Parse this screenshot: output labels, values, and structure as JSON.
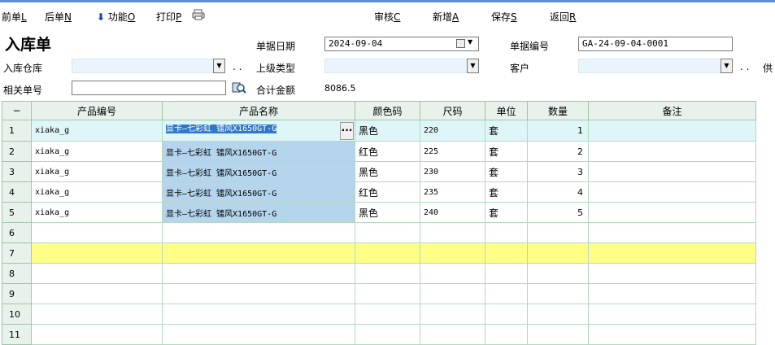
{
  "toolbar": {
    "prev": {
      "label": "前单",
      "key": "L"
    },
    "next": {
      "label": "后单",
      "key": "N"
    },
    "function": {
      "label": "功能",
      "key": "O"
    },
    "print": {
      "label": "打印",
      "key": "P"
    },
    "review": {
      "label": "审核",
      "key": "C"
    },
    "new": {
      "label": "新增",
      "key": "A"
    },
    "save": {
      "label": "保存",
      "key": "S"
    },
    "back": {
      "label": "返回",
      "key": "R"
    }
  },
  "form": {
    "title": "入库单",
    "date_label": "单据日期",
    "date_value": "2024-09-04",
    "docno_label": "单据编号",
    "docno_value": "GA-24-09-04-0001",
    "warehouse_label": "入库仓库",
    "warehouse_value": "",
    "parent_type_label": "上级类型",
    "parent_type_value": "",
    "customer_label": "客户",
    "customer_value": "",
    "supplier_label_partial": "供",
    "related_label": "相关单号",
    "related_value": "",
    "total_label": "合计金额",
    "total_value": "8086.5",
    "ellipsis": ". ."
  },
  "grid": {
    "corner": "−",
    "headers": [
      "产品编号",
      "产品名称",
      "颜色码",
      "尺码",
      "单位",
      "数量",
      "备注"
    ],
    "rows": [
      {
        "n": "1",
        "code": "xiaka_g",
        "name": "显卡—七彩虹 镭风X1650GT-G",
        "color": "黑色",
        "size": "220",
        "unit": "套",
        "qty": "1",
        "note": ""
      },
      {
        "n": "2",
        "code": "xiaka_g",
        "name": "显卡—七彩虹 镭风X1650GT-G",
        "color": "红色",
        "size": "225",
        "unit": "套",
        "qty": "2",
        "note": ""
      },
      {
        "n": "3",
        "code": "xiaka_g",
        "name": "显卡—七彩虹 镭风X1650GT-G",
        "color": "黑色",
        "size": "230",
        "unit": "套",
        "qty": "3",
        "note": ""
      },
      {
        "n": "4",
        "code": "xiaka_g",
        "name": "显卡—七彩虹 镭风X1650GT-G",
        "color": "红色",
        "size": "235",
        "unit": "套",
        "qty": "4",
        "note": ""
      },
      {
        "n": "5",
        "code": "xiaka_g",
        "name": "显卡—七彩虹 镭风X1650GT-G",
        "color": "黑色",
        "size": "240",
        "unit": "套",
        "qty": "5",
        "note": ""
      },
      {
        "n": "6",
        "code": "",
        "name": "",
        "color": "",
        "size": "",
        "unit": "",
        "qty": "",
        "note": ""
      },
      {
        "n": "7",
        "code": "",
        "name": "",
        "color": "",
        "size": "",
        "unit": "",
        "qty": "",
        "note": ""
      },
      {
        "n": "8",
        "code": "",
        "name": "",
        "color": "",
        "size": "",
        "unit": "",
        "qty": "",
        "note": ""
      },
      {
        "n": "9",
        "code": "",
        "name": "",
        "color": "",
        "size": "",
        "unit": "",
        "qty": "",
        "note": ""
      },
      {
        "n": "10",
        "code": "",
        "name": "",
        "color": "",
        "size": "",
        "unit": "",
        "qty": "",
        "note": ""
      },
      {
        "n": "11",
        "code": "",
        "name": "",
        "color": "",
        "size": "",
        "unit": "",
        "qty": "",
        "note": ""
      }
    ]
  },
  "colors": {
    "header_bg": "#e8f2ea",
    "current_row": "#dff6f8",
    "highlight_row": "#ffff88",
    "name_cell": "#b4d5ec",
    "selection": "#3078c8"
  },
  "icons": {
    "function": "arrow-down-icon",
    "print": "printer-icon",
    "lookup": "magnifier-icon",
    "cell_editor": "ellipsis-button"
  }
}
